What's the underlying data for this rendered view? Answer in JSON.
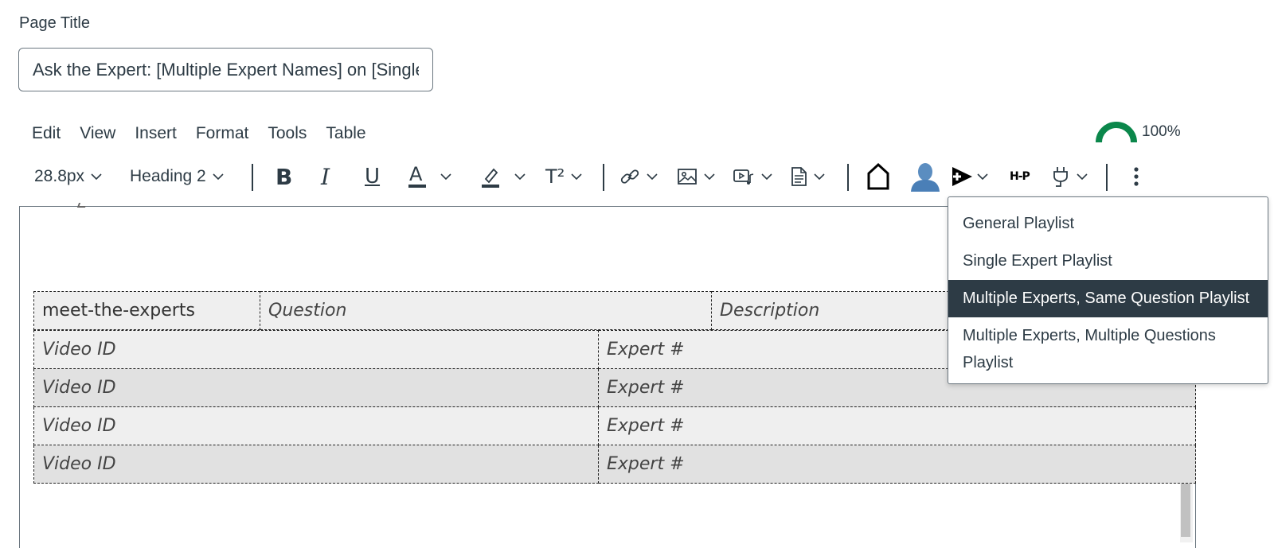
{
  "page_title_label": "Page Title",
  "title_input_value": "Ask the Expert: [Multiple Expert Names] on [Single Question]",
  "menubar": [
    "Edit",
    "View",
    "Insert",
    "Format",
    "Tools",
    "Table"
  ],
  "a11y_checker": {
    "percent_text": "100%",
    "color": "#0b874b"
  },
  "toolbar": {
    "font_size": "28.8px",
    "block_format": "Heading 2",
    "bold": "B",
    "italic": "I",
    "underline": "U",
    "text_color": "A",
    "superscript": "T²",
    "h5p": "H-P",
    "icons": [
      "bold-icon",
      "italic-icon",
      "underline-icon",
      "text-color-icon",
      "highlight-icon",
      "superscript-icon",
      "link-icon",
      "image-icon",
      "media-icon",
      "document-icon",
      "home-icon",
      "avatar-icon",
      "playlist-icon",
      "h5p-icon",
      "plug-icon",
      "more-options-icon"
    ]
  },
  "table": {
    "header": [
      "meet-the-experts",
      "Question",
      "Description"
    ],
    "rows": [
      [
        "Video ID",
        "Expert #"
      ],
      [
        "Video ID",
        "Expert #"
      ],
      [
        "Video ID",
        "Expert #"
      ],
      [
        "Video ID",
        "Expert #"
      ]
    ]
  },
  "dropdown": {
    "items": [
      "General Playlist",
      "Single Expert Playlist",
      "Multiple Experts, Same Question Playlist",
      "Multiple Experts, Multiple Questions Playlist"
    ],
    "selected_index": 2
  }
}
